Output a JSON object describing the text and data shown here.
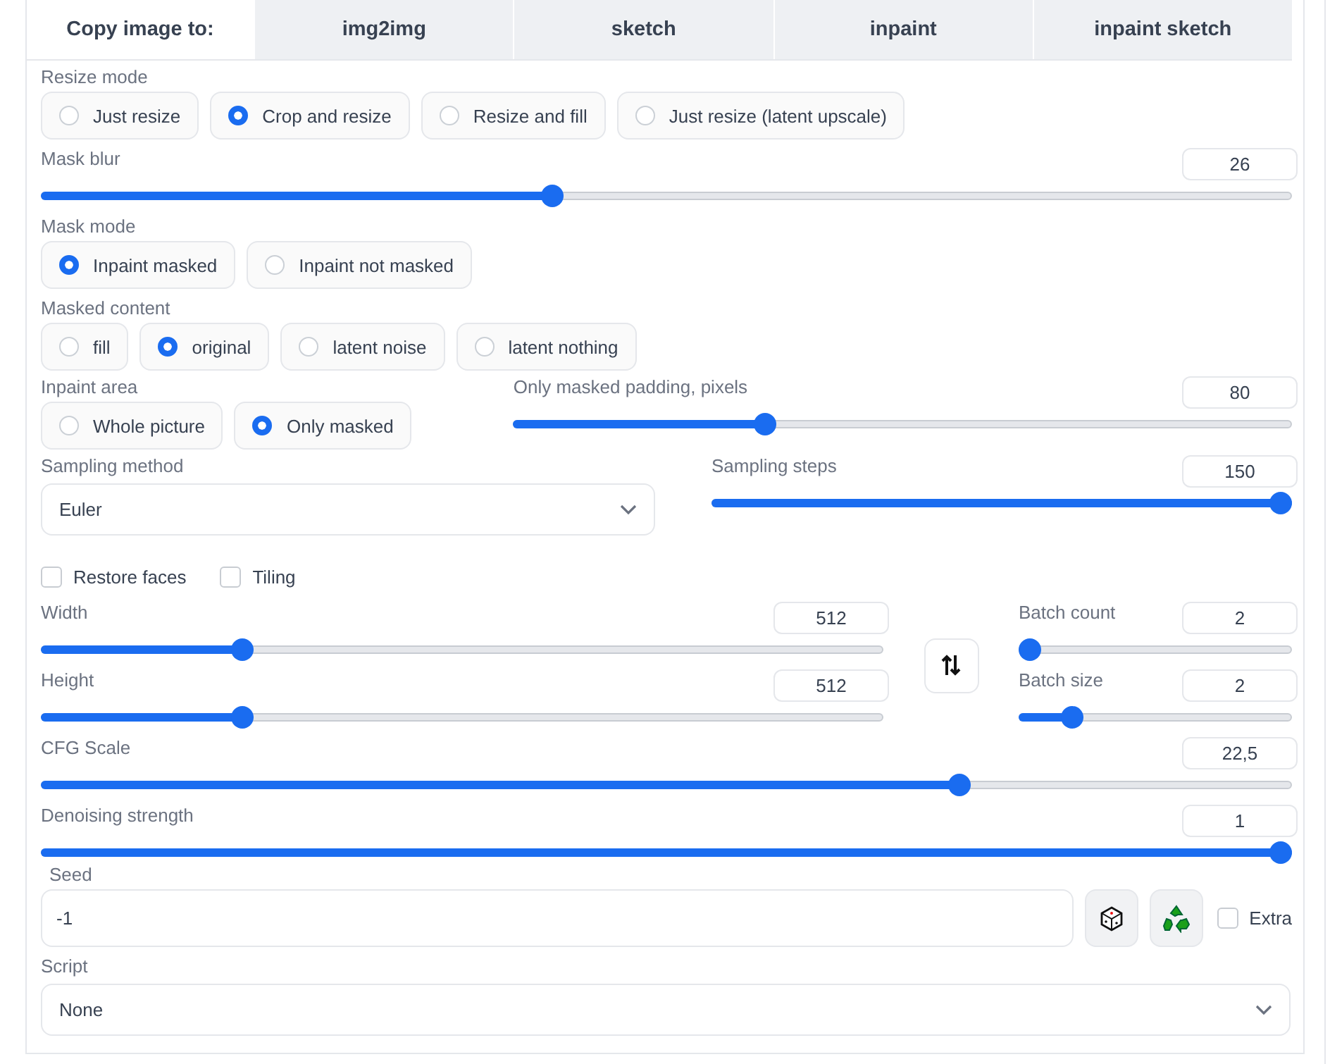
{
  "copy_to": {
    "label": "Copy image to:",
    "buttons": [
      "img2img",
      "sketch",
      "inpaint",
      "inpaint sketch"
    ]
  },
  "resize_mode": {
    "label": "Resize mode",
    "options": [
      {
        "label": "Just resize",
        "selected": false
      },
      {
        "label": "Crop and resize",
        "selected": true
      },
      {
        "label": "Resize and fill",
        "selected": false
      },
      {
        "label": "Just resize (latent upscale)",
        "selected": false
      }
    ]
  },
  "mask_blur": {
    "label": "Mask blur",
    "value": "26",
    "level": 0.407
  },
  "mask_mode": {
    "label": "Mask mode",
    "options": [
      {
        "label": "Inpaint masked",
        "selected": true
      },
      {
        "label": "Inpaint not masked",
        "selected": false
      }
    ]
  },
  "masked_content": {
    "label": "Masked content",
    "options": [
      {
        "label": "fill",
        "selected": false
      },
      {
        "label": "original",
        "selected": true
      },
      {
        "label": "latent noise",
        "selected": false
      },
      {
        "label": "latent nothing",
        "selected": false
      }
    ]
  },
  "inpaint_area": {
    "label": "Inpaint area",
    "options": [
      {
        "label": "Whole picture",
        "selected": false
      },
      {
        "label": "Only masked",
        "selected": true
      }
    ]
  },
  "only_masked_padding": {
    "label": "Only masked padding, pixels",
    "value": "80",
    "level": 0.318
  },
  "sampling_method": {
    "label": "Sampling method",
    "value": "Euler"
  },
  "sampling_steps": {
    "label": "Sampling steps",
    "value": "150",
    "level": 1
  },
  "checkboxes": [
    {
      "label": "Restore faces",
      "checked": false
    },
    {
      "label": "Tiling",
      "checked": false
    }
  ],
  "width": {
    "label": "Width",
    "value": "512",
    "level": 0.232
  },
  "height": {
    "label": "Height",
    "value": "512",
    "level": 0.232
  },
  "batch_count": {
    "label": "Batch count",
    "value": "2",
    "level": 0
  },
  "batch_size": {
    "label": "Batch size",
    "value": "2",
    "level": 0.168
  },
  "cfg_scale": {
    "label": "CFG Scale",
    "value": "22,5",
    "level": 0.738
  },
  "denoising_strength": {
    "label": "Denoising strength",
    "value": "1",
    "level": 1
  },
  "seed": {
    "label": "Seed",
    "value": "-1"
  },
  "extra": {
    "label": "Extra",
    "checked": false
  },
  "script": {
    "label": "Script",
    "value": "None"
  }
}
